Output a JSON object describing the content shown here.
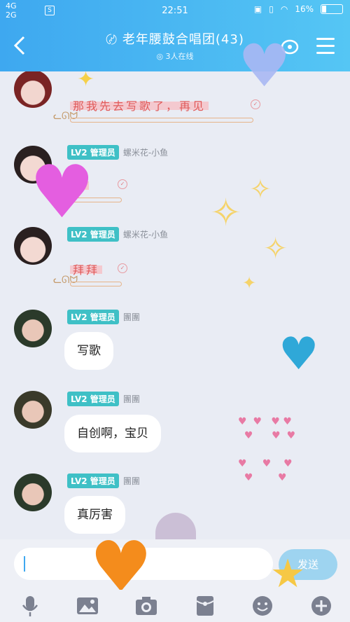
{
  "status": {
    "network_top": "4G",
    "network_bottom": "2G",
    "sim_badge": "S",
    "time": "22:51",
    "battery": "16%"
  },
  "header": {
    "title": "老年腰鼓合唱团(43)",
    "online": "3人在线",
    "icons": [
      "back-arrow-icon",
      "ear-icon",
      "group-settings-icon",
      "menu-icon"
    ]
  },
  "messages": [
    {
      "type": "sticker",
      "text": "那我先去写歌了，再见"
    },
    {
      "tag": "LV2 管理员",
      "nick": "螺米花-小鱼",
      "type": "sticker",
      "text": "嗯"
    },
    {
      "tag": "LV2 管理员",
      "nick": "螺米花-小鱼",
      "type": "sticker",
      "text": "拜拜"
    },
    {
      "tag": "LV2 管理员",
      "nick": "團團",
      "type": "bubble",
      "text": "写歌"
    },
    {
      "tag": "LV2 管理员",
      "nick": "團團",
      "type": "bubble",
      "text": "自创啊，宝贝"
    },
    {
      "tag": "LV2 管理员",
      "nick": "團團",
      "type": "bubble",
      "text": "真厉害"
    }
  ],
  "input": {
    "value": "",
    "send_label": "发送"
  },
  "toolbar": [
    "microphone-icon",
    "image-icon",
    "camera-icon",
    "red-packet-icon",
    "emoji-icon",
    "plus-icon"
  ],
  "colors": {
    "header": "#3ea8f0",
    "tag": "#3fc0c6",
    "background": "#e9ecf4"
  }
}
